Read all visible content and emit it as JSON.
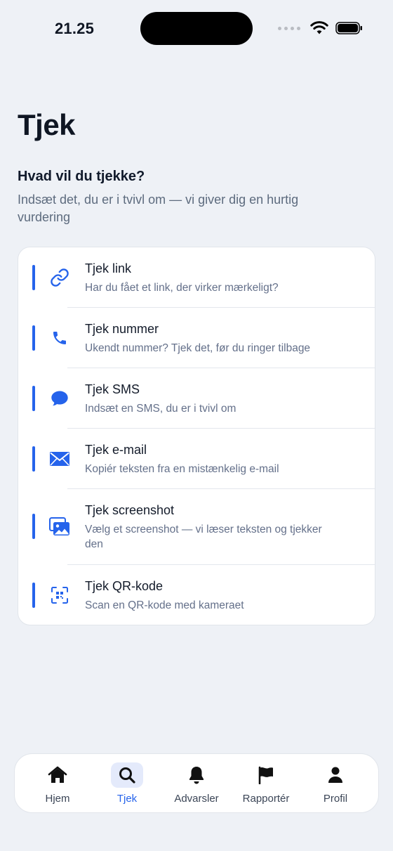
{
  "status_bar": {
    "time": "21.25"
  },
  "page": {
    "title": "Tjek",
    "heading": "Hvad vil du tjekke?",
    "subtitle": "Indsæt det, du er i tvivl om — vi giver dig en hurtig vurdering"
  },
  "checks": [
    {
      "icon": "link-icon",
      "title": "Tjek link",
      "description": "Har du fået et link, der virker mærkeligt?"
    },
    {
      "icon": "phone-icon",
      "title": "Tjek nummer",
      "description": "Ukendt nummer? Tjek det, før du ringer tilbage"
    },
    {
      "icon": "message-bubble-icon",
      "title": "Tjek SMS",
      "description": "Indsæt en SMS, du er i tvivl om"
    },
    {
      "icon": "envelope-icon",
      "title": "Tjek e-mail",
      "description": "Kopiér teksten fra en mistænkelig e-mail"
    },
    {
      "icon": "photos-icon",
      "title": "Tjek screenshot",
      "description": "Vælg et screenshot — vi læser teksten og tjekker den"
    },
    {
      "icon": "qr-scan-icon",
      "title": "Tjek QR-kode",
      "description": "Scan en QR-kode med kameraet"
    }
  ],
  "tabbar": {
    "active": "Tjek",
    "tabs": [
      {
        "label": "Hjem",
        "icon": "home-icon"
      },
      {
        "label": "Tjek",
        "icon": "search-icon"
      },
      {
        "label": "Advarsler",
        "icon": "bell-icon"
      },
      {
        "label": "Rapportér",
        "icon": "flag-icon"
      },
      {
        "label": "Profil",
        "icon": "person-icon"
      }
    ]
  },
  "colors": {
    "accent": "#2563eb",
    "background": "#eef1f6",
    "card": "#ffffff",
    "muted_text": "#64708a"
  }
}
